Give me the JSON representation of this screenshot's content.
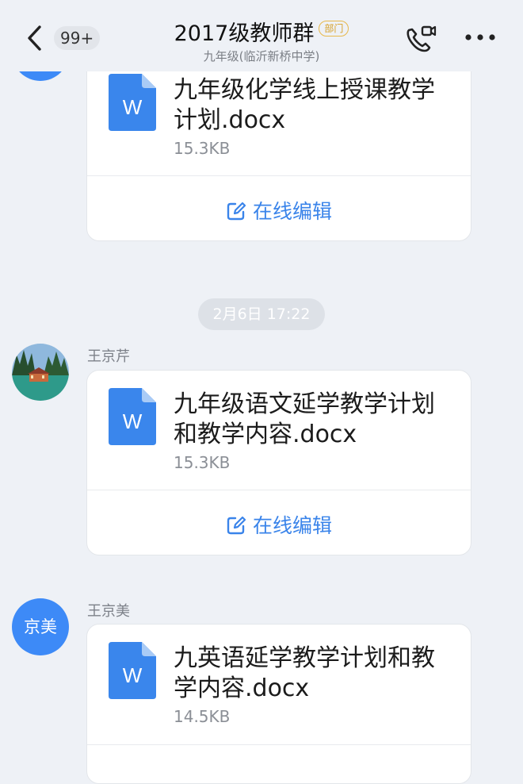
{
  "header": {
    "back_count": "99+",
    "title": "2017级教师群",
    "dept_tag": "部门",
    "subtitle": "九年级(临沂新桥中学)"
  },
  "colors": {
    "accent": "#3a84ea",
    "avatar_blue": "#3d8af7",
    "dept_tag": "#d7a12a"
  },
  "time_divider": "2月6日 17:22",
  "messages": [
    {
      "file_name": "九年级化学线上授课教学计划.docx",
      "size": "15.3KB",
      "edit_label": "在线编辑"
    },
    {
      "sender": "王京芹",
      "avatar": "photo",
      "file_name": "九年级语文延学教学计划和教学内容.docx",
      "size": "15.3KB",
      "edit_label": "在线编辑"
    },
    {
      "sender": "王京美",
      "avatar_text": "京美",
      "file_name": "九英语延学教学计划和教学内容.docx",
      "size": "14.5KB"
    }
  ]
}
